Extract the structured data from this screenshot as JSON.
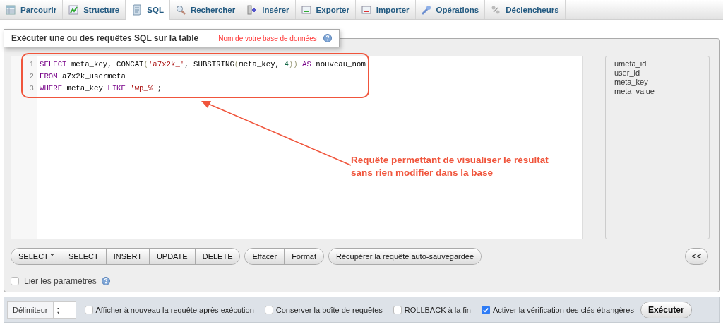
{
  "tabs": [
    {
      "label": "Parcourir",
      "selected": false
    },
    {
      "label": "Structure",
      "selected": false
    },
    {
      "label": "SQL",
      "selected": true
    },
    {
      "label": "Rechercher",
      "selected": false
    },
    {
      "label": "Insérer",
      "selected": false
    },
    {
      "label": "Exporter",
      "selected": false
    },
    {
      "label": "Importer",
      "selected": false
    },
    {
      "label": "Opérations",
      "selected": false
    },
    {
      "label": "Déclencheurs",
      "selected": false
    }
  ],
  "query_box": {
    "title": "Exécuter une ou des requêtes SQL sur la table",
    "database_note": "Nom de votre base de données",
    "code_lines": [
      {
        "number": "1",
        "tokens": [
          {
            "kind": "keyword",
            "text": "SELECT"
          },
          {
            "kind": "plain",
            "text": " meta_key, CONCAT"
          },
          {
            "kind": "bracket",
            "text": "("
          },
          {
            "kind": "string",
            "text": "'a7x2k_'"
          },
          {
            "kind": "plain",
            "text": ", SUBSTRING"
          },
          {
            "kind": "bracket",
            "text": "("
          },
          {
            "kind": "plain",
            "text": "meta_key, "
          },
          {
            "kind": "number",
            "text": "4"
          },
          {
            "kind": "bracket",
            "text": "))"
          },
          {
            "kind": "keyword",
            "text": " AS"
          },
          {
            "kind": "plain",
            "text": " nouveau_nom"
          }
        ]
      },
      {
        "number": "2",
        "tokens": [
          {
            "kind": "keyword",
            "text": "FROM"
          },
          {
            "kind": "plain",
            "text": " a7x2k_usermeta"
          }
        ]
      },
      {
        "number": "3",
        "tokens": [
          {
            "kind": "keyword",
            "text": "WHERE"
          },
          {
            "kind": "plain",
            "text": " meta_key "
          },
          {
            "kind": "keyword",
            "text": "LIKE"
          },
          {
            "kind": "string",
            "text": " 'wp_%'"
          },
          {
            "kind": "plain",
            "text": ";"
          }
        ]
      }
    ],
    "columns": [
      "umeta_id",
      "user_id",
      "meta_key",
      "meta_value"
    ],
    "button_groups": [
      {
        "buttons": [
          "SELECT *",
          "SELECT",
          "INSERT",
          "UPDATE",
          "DELETE"
        ]
      },
      {
        "buttons": [
          "Effacer",
          "Format"
        ]
      },
      {
        "buttons": [
          "Récupérer la requête auto-sauvegardée"
        ]
      }
    ],
    "insert_column_button": "<<",
    "bind_parameters": {
      "label": "Lier les paramètres",
      "checked": false
    },
    "annotation": {
      "lines": [
        "Requête permettant de visualiser le résultat",
        "sans rien modifier dans la base"
      ]
    }
  },
  "footer": {
    "delimiter_label": "Délimiteur",
    "delimiter_value": ";",
    "options": [
      {
        "label": "Afficher à nouveau la requête après exécution",
        "checked": false
      },
      {
        "label": "Conserver la boîte de requêtes",
        "checked": false
      },
      {
        "label": "ROLLBACK à la fin",
        "checked": false
      },
      {
        "label": "Activer la vérification des clés étrangères",
        "checked": true
      }
    ],
    "submit": "Exécuter"
  }
}
